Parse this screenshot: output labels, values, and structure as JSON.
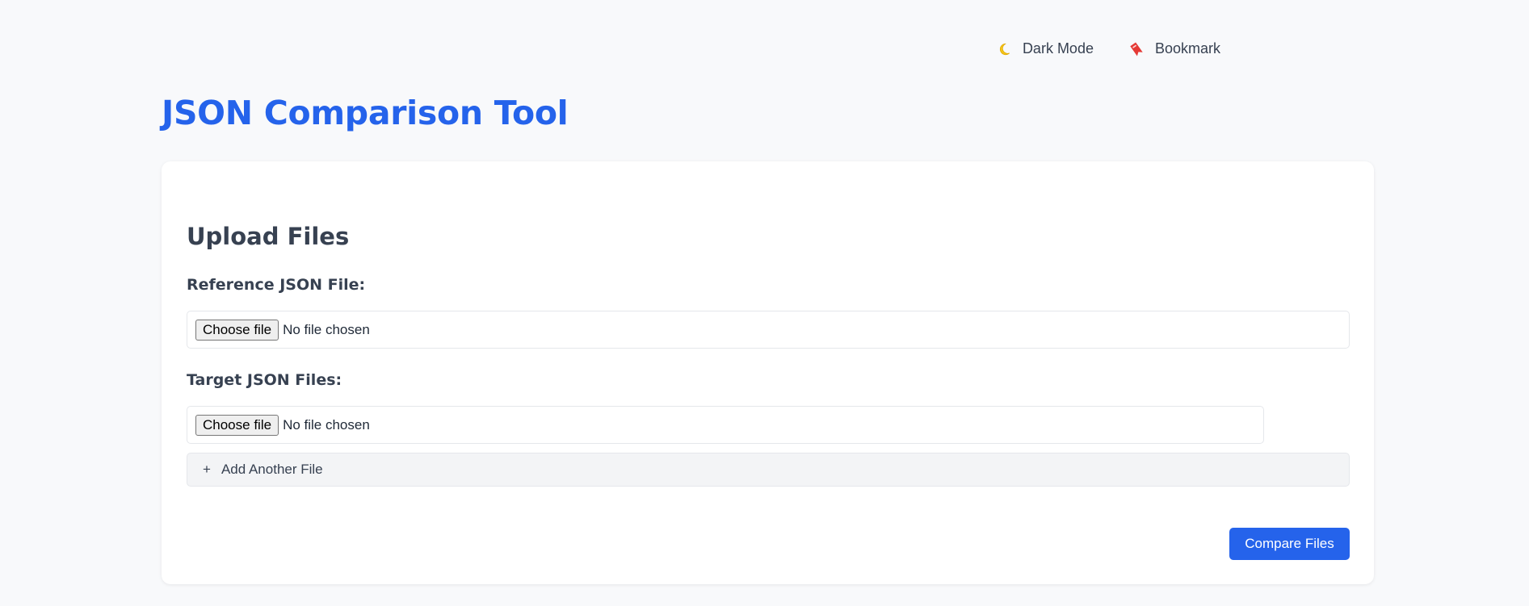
{
  "header": {
    "title": "JSON Comparison Tool",
    "actions": [
      {
        "label": "Dark Mode",
        "icon": "moon-icon"
      },
      {
        "label": "Bookmark",
        "icon": "bookmark-icon"
      }
    ]
  },
  "upload": {
    "title": "Upload Files",
    "reference": {
      "label": "Reference JSON File:",
      "button_label": "Choose file",
      "status": "No file chosen"
    },
    "targets": {
      "label": "Target JSON Files:",
      "files": [
        {
          "button_label": "Choose file",
          "status": "No file chosen"
        }
      ],
      "add_icon": "+",
      "add_label": "Add Another File"
    },
    "compare_label": "Compare Files"
  },
  "colors": {
    "accent": "#2563eb",
    "background": "#f8f9fb",
    "moon": "#f5c518",
    "bookmark": "#e53935"
  }
}
